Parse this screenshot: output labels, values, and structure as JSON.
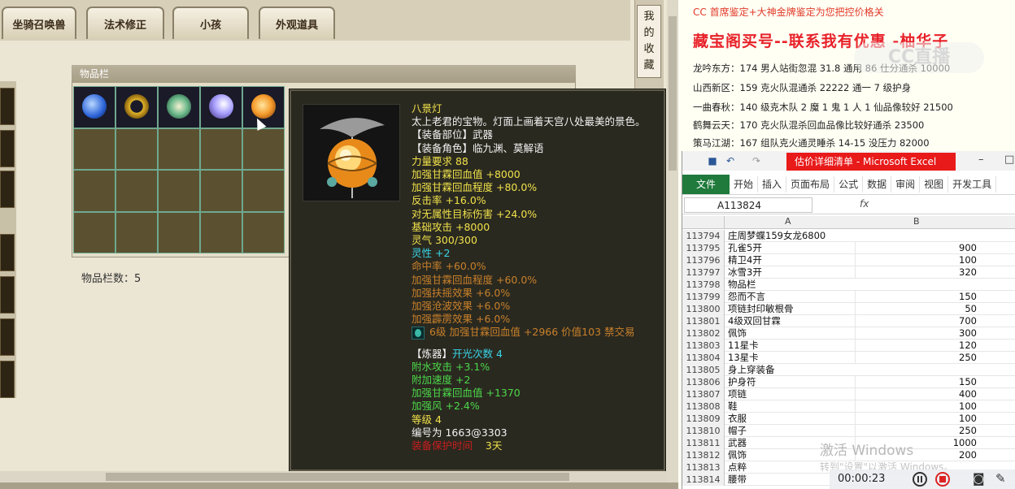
{
  "game": {
    "tabs": [
      "坐骑召唤兽",
      "法术修正",
      "小孩",
      "外观道具"
    ],
    "side_label": [
      "我",
      "的",
      "收",
      "藏"
    ],
    "inventory_title": "物品栏",
    "inventory_count": "物品栏数：5",
    "item_colors": [
      "#3b8bff",
      "#e0a820",
      "#6ab88a",
      "#a9a0ff",
      "#f59a2a"
    ]
  },
  "tooltip": {
    "name": "八景灯",
    "desc": "太上老君的宝物。灯面上画着天宫八处最美的景色。",
    "slot": "【装备部位】武器",
    "role": "【装备角色】临九渊、莫解语",
    "stats_yellow": [
      "力量要求 88",
      "加强甘霖回血值 +8000",
      "加强甘霖回血程度 +80.0%",
      "反击率 +16.0%",
      "对无属性目标伤害 +24.0%",
      "基础攻击 +8000",
      "灵气 300/300"
    ],
    "spirit": "灵性 +2",
    "stats_orange": [
      "命中率 +60.0%",
      "加强甘霖回血程度 +60.0%",
      "加强扶摇效果 +6.0%",
      "加强沧波效果 +6.0%",
      "加强霹雳效果 +6.0%"
    ],
    "gem_line": "6级 加强甘霖回血值 +2966 价值103 禁交易",
    "refine_label": "【炼器】",
    "refine_count": "开光次数 4",
    "stats_green": [
      "附水攻击 +3.1%",
      "附加速度 +2",
      "加强甘霖回血值 +1370",
      "加强风 +2.4%"
    ],
    "level": "等级 4",
    "serial": "编号为 1663@3303",
    "protect_label": "装备保护时间",
    "protect_days": "3天"
  },
  "doc": {
    "header": "CC 首席鉴定+大神金牌鉴定为您把控价格关",
    "title": "藏宝阁买号--联系我有优惠 -柚华子",
    "items": [
      "龙吟东方：174 男人站街忽混 31.8 通用 86 仕分通杀 10000",
      "山西新区：159 克火队混通杀 22222 通一 7 级护身",
      "一曲春秋：140 级克木队 2 魔 1 鬼 1 人 1 仙品像较好 21500",
      "鹤舞云天：170 克火队混杀回血品像比较好通杀 23500",
      "策马江湖：167 组队克火通灵睡杀 14-15 没压力 82000"
    ],
    "watermark": "CC直播"
  },
  "excel": {
    "title": "估价详细清单 - Microsoft Excel",
    "ribbon_tabs": [
      "文件",
      "开始",
      "插入",
      "页面布局",
      "公式",
      "数据",
      "审阅",
      "视图",
      "开发工具"
    ],
    "name_box": "A113824",
    "fx": "fx",
    "col_a": "A",
    "col_b": "B",
    "rows": [
      {
        "n": "113794",
        "a": "庄周梦蝶159女龙6800",
        "b": ""
      },
      {
        "n": "113795",
        "a": "孔雀5开",
        "b": "900"
      },
      {
        "n": "113796",
        "a": "精卫4开",
        "b": "100"
      },
      {
        "n": "113797",
        "a": "冰雪3开",
        "b": "320"
      },
      {
        "n": "113798",
        "a": "物品栏",
        "b": ""
      },
      {
        "n": "113799",
        "a": "怨而不言",
        "b": "150"
      },
      {
        "n": "113800",
        "a": "项链封印敏根骨",
        "b": "50"
      },
      {
        "n": "113801",
        "a": "4级双回甘霖",
        "b": "700"
      },
      {
        "n": "113802",
        "a": "佩饰",
        "b": "300"
      },
      {
        "n": "113803",
        "a": "11星卡",
        "b": "120"
      },
      {
        "n": "113804",
        "a": "13星卡",
        "b": "250"
      },
      {
        "n": "113805",
        "a": "身上穿装备",
        "b": ""
      },
      {
        "n": "113806",
        "a": "护身符",
        "b": "150"
      },
      {
        "n": "113807",
        "a": "项链",
        "b": "400"
      },
      {
        "n": "113808",
        "a": "鞋",
        "b": "100"
      },
      {
        "n": "113809",
        "a": "衣服",
        "b": "100"
      },
      {
        "n": "113810",
        "a": "帽子",
        "b": "250"
      },
      {
        "n": "113811",
        "a": "武器",
        "b": "1000"
      },
      {
        "n": "113812",
        "a": "佩饰",
        "b": "200"
      },
      {
        "n": "113813",
        "a": "点粹",
        "b": ""
      },
      {
        "n": "113814",
        "a": "腰带",
        "b": ""
      }
    ]
  },
  "system": {
    "activate_title": "激活 Windows",
    "activate_sub": "转到\"设置\"以激活 Windows。",
    "rec_time": "00:00:23"
  }
}
